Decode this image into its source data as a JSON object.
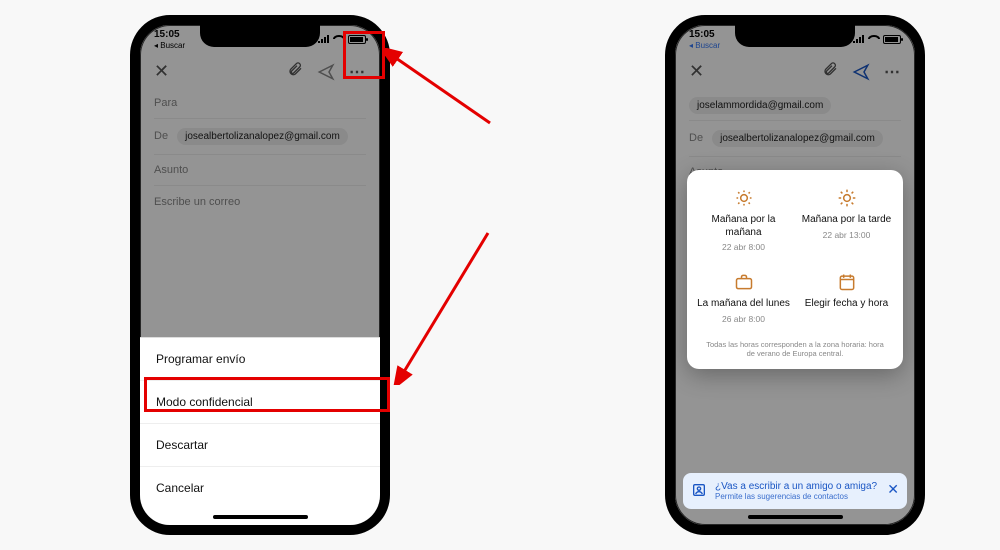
{
  "statusbar": {
    "time": "15:05",
    "back": "Buscar"
  },
  "compose": {
    "to_label": "Para",
    "from_label": "De",
    "from_address_left": "josealbertolizanalopez@gmail.com",
    "to_address_right": "joselammordida@gmail.com",
    "from_address_right": "josealbertolizanalopez@gmail.com",
    "subject": "Asunto",
    "body_placeholder": "Escribe un correo"
  },
  "actions": {
    "schedule": "Programar envío",
    "confidential": "Modo confidencial",
    "discard": "Descartar",
    "cancel": "Cancelar"
  },
  "schedule_card": {
    "opts": [
      {
        "title": "Mañana por la mañana",
        "sub": "22 abr 8:00"
      },
      {
        "title": "Mañana por la tarde",
        "sub": "22 abr 13:00"
      },
      {
        "title": "La mañana del lunes",
        "sub": "26 abr 8:00"
      },
      {
        "title": "Elegir fecha y hora",
        "sub": ""
      }
    ],
    "note": "Todas las horas corresponden a la zona horaria: hora de verano de Europa central."
  },
  "banner": {
    "title": "¿Vas a escribir a un amigo o amiga?",
    "sub": "Permite las sugerencias de contactos"
  }
}
